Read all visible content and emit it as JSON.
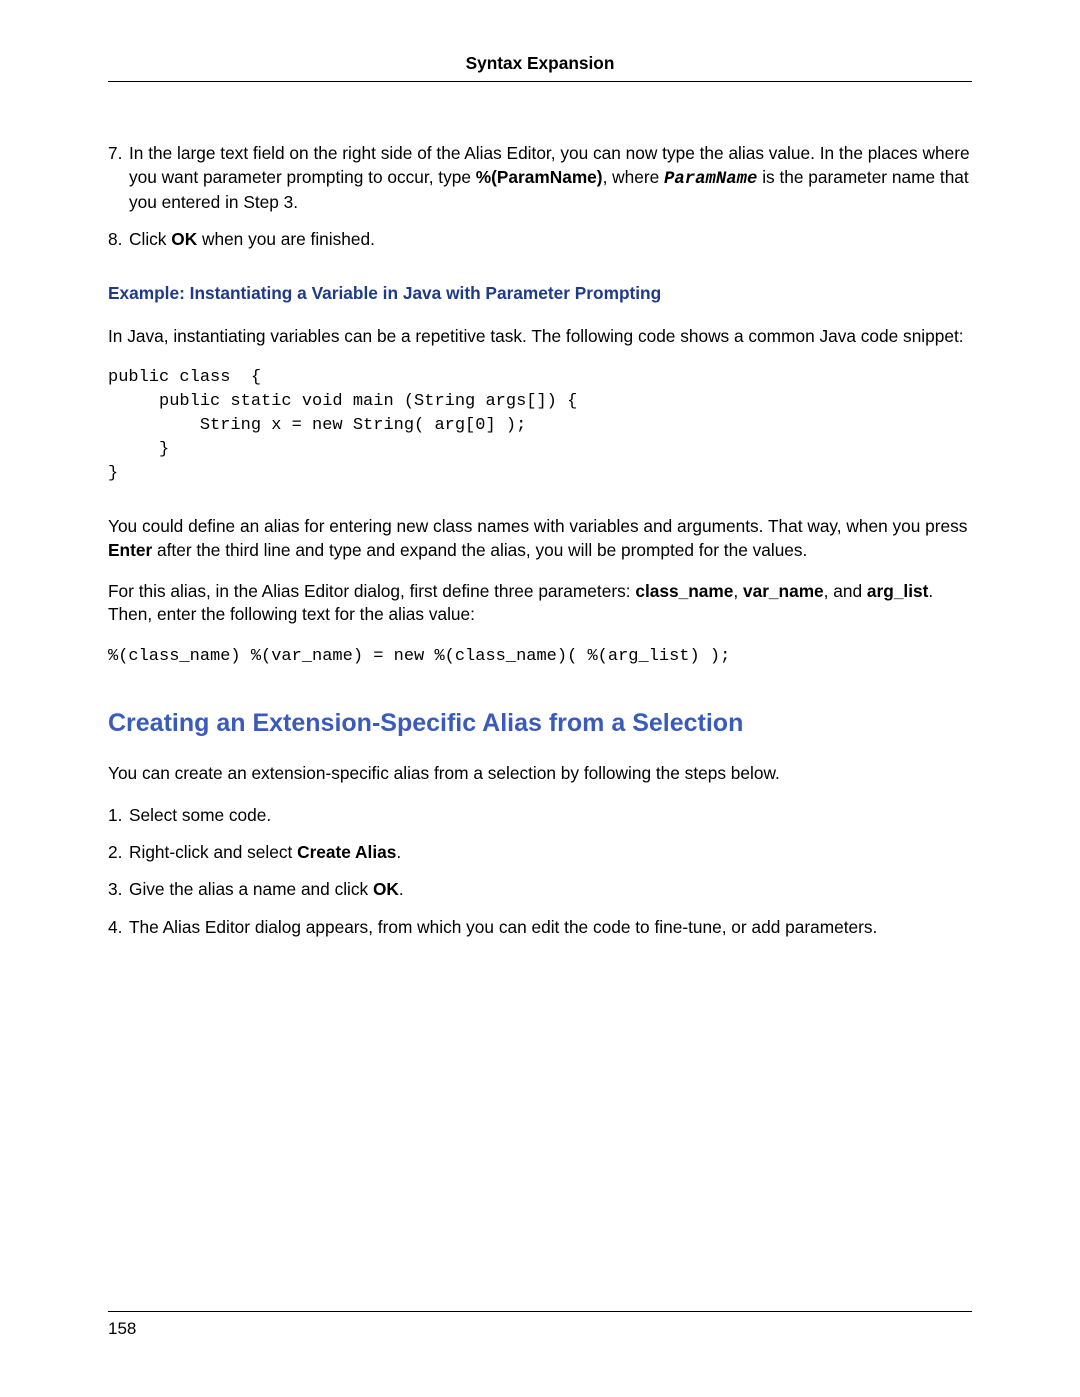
{
  "header": {
    "title": "Syntax Expansion"
  },
  "steps1": {
    "item7": {
      "num": "7.",
      "text_a": "In the large text field on the right side of the Alias Editor, you can now type the alias value. In the places where you want parameter prompting to occur, type ",
      "bold_a": "%(ParamName)",
      "text_b": ", where ",
      "mono_a": "ParamName",
      "text_c": " is the parameter name that you entered in Step 3."
    },
    "item8": {
      "num": "8.",
      "text_a": "Click ",
      "bold_a": "OK",
      "text_b": " when you are finished."
    }
  },
  "example": {
    "heading": "Example: Instantiating a Variable in Java with Parameter Prompting"
  },
  "para1": "In Java, instantiating variables can be a repetitive task. The following code shows a common Java code snippet:",
  "code1": "public class  {\n     public static void main (String args[]) {\n         String x = new String( arg[0] );\n     }\n}",
  "para2": {
    "a": "You could define an alias for entering new class names with variables and arguments. That way, when you press ",
    "b": "Enter",
    "c": " after the third line and type and expand the alias, you will be prompted for the values."
  },
  "para3": {
    "a": "For this alias, in the Alias Editor dialog, first define three parameters: ",
    "b1": "class_name",
    "s1": ", ",
    "b2": "var_name",
    "s2": ", and ",
    "b3": "arg_list",
    "c": ". Then, enter the following text for the alias value:"
  },
  "code2": "%(class_name) %(var_name) = new %(class_name)( %(arg_list) );",
  "section2": {
    "heading": "Creating an Extension-Specific Alias from a Selection"
  },
  "para4": "You can create an extension-specific alias from a selection by following the steps below.",
  "steps2": {
    "item1": {
      "num": "1.",
      "text": "Select some code."
    },
    "item2": {
      "num": "2.",
      "a": "Right-click and select ",
      "b": "Create Alias",
      "c": "."
    },
    "item3": {
      "num": "3.",
      "a": "Give the alias a name and click ",
      "b": "OK",
      "c": "."
    },
    "item4": {
      "num": "4.",
      "text": "The Alias Editor dialog appears, from which you can edit the code to fine-tune, or add parameters."
    }
  },
  "footer": {
    "page_number": "158"
  }
}
